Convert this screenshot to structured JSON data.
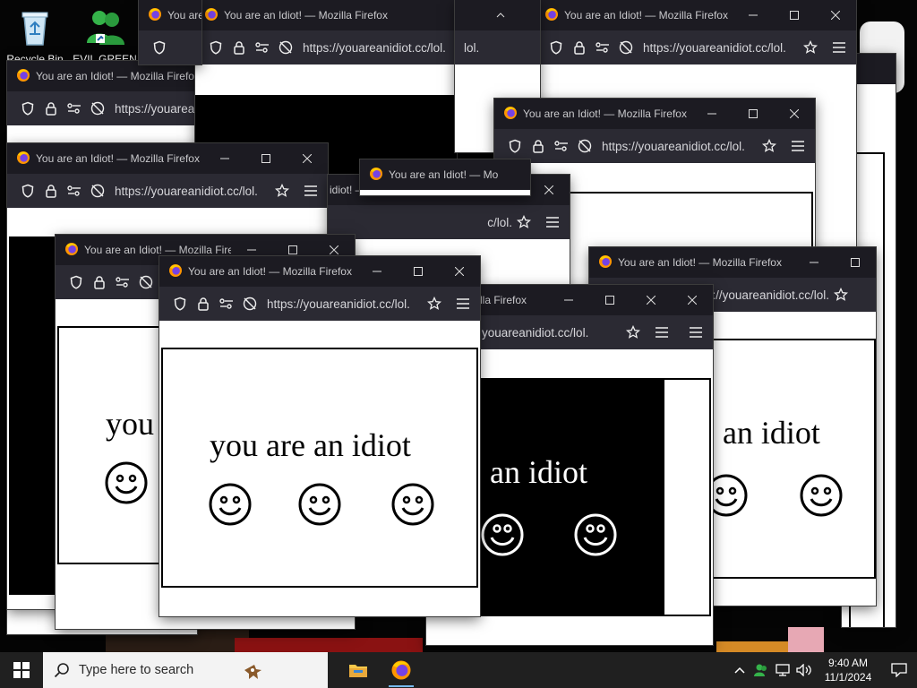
{
  "desktop": {
    "icons": [
      {
        "label": "Recycle Bin",
        "icon": "recycle-bin-icon"
      },
      {
        "label": "EVIL GREEN",
        "icon": "users-icon"
      }
    ]
  },
  "browser": {
    "window_title": "You are an Idiot! — Mozilla Firefox",
    "window_title_fragment_a": "You are an Idiot! — Mozilla Firefox",
    "title_partial_1": "You are",
    "title_partial_2": "idiot! — Mozilla Firefox",
    "title_partial_3": "You are an Idiot! — Mo",
    "title_partial_4": "lla Firefox",
    "title_partial_5": "diot!",
    "title_partial_6": "diot!",
    "url": "https://youareanidiot.cc/lol.",
    "url_host": "https://youareanidiot.cc/",
    "url_path": "lol.",
    "url_partial_1": "youareanidiot.cc/lol.",
    "url_partial_2": "ps://youareanidiot.cc/lol.",
    "url_partial_3": "c/lol.",
    "url_partial_4": "https://youarea",
    "url_partial_5": "yo",
    "url_partial_6": "lol.",
    "url_partial_7": "https://youareanidiot.cc/lol.",
    "controls": {
      "minimize": "minimize-icon",
      "maximize": "maximize-icon",
      "close": "close-icon"
    },
    "page_text": "you are an idiot",
    "page_text_partial_1": "you",
    "page_text_partial_2": "re an idiot",
    "page_text_partial_3": "are an idiot"
  },
  "taskbar": {
    "search_placeholder": "Type here to search",
    "apps": [
      {
        "name": "File Explorer",
        "icon": "folder-icon"
      },
      {
        "name": "Firefox",
        "icon": "firefox-icon"
      }
    ],
    "time": "9:40 AM",
    "date": "11/1/2024"
  },
  "colors": {
    "titlebar": "#1c1b22",
    "toolbar": "#2b2a33",
    "taskbar": "#202020",
    "accent": "#76b9ed"
  }
}
